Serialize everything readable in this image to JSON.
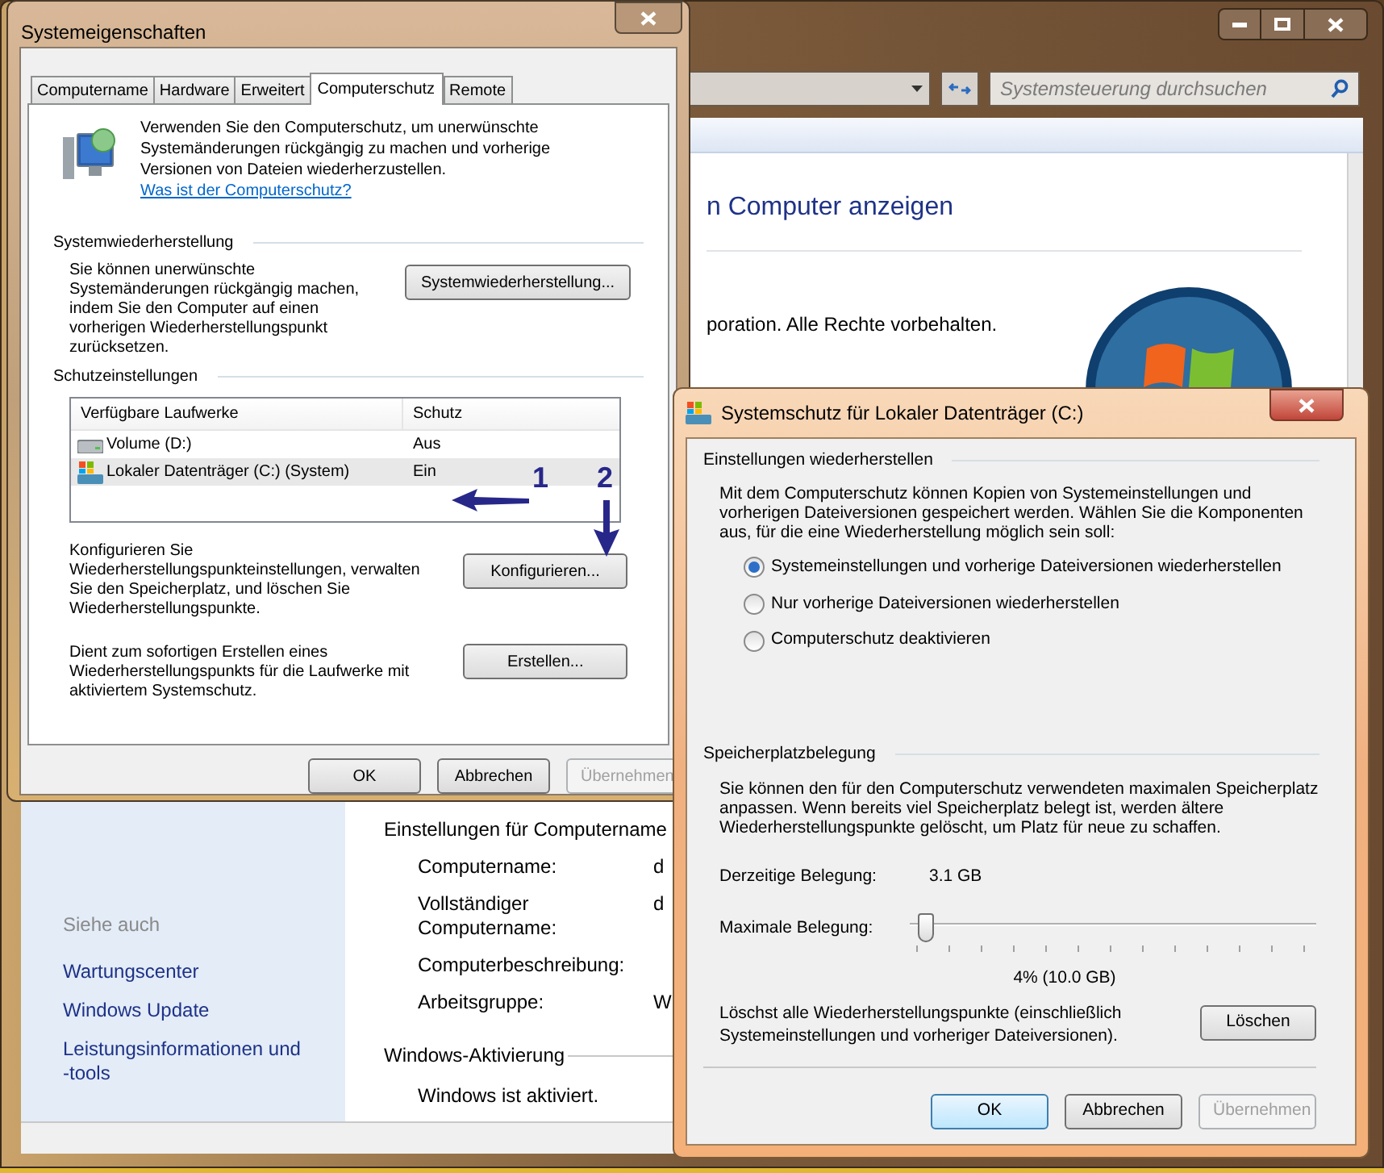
{
  "background_window": {
    "search": {
      "placeholder": "Systemsteuerung durchsuchen"
    },
    "heading": "n Computer anzeigen",
    "copyright": "poration. Alle Rechte vorbehalten.",
    "see_also": {
      "title": "Siehe auch",
      "links": [
        "Wartungscenter",
        "Windows Update",
        "Leistungsinformationen und -tools"
      ]
    },
    "computer_section": {
      "title": "Einstellungen für Computername",
      "rows": [
        {
          "label": "Computername:",
          "value": "d"
        },
        {
          "label": "Vollständiger Computername:",
          "value": "d"
        },
        {
          "label": "Computerbeschreibung:"
        },
        {
          "label": "Arbeitsgruppe:",
          "value": "W"
        }
      ]
    },
    "activation": {
      "title": "Windows-Aktivierung",
      "status": "Windows ist aktiviert."
    }
  },
  "system_properties": {
    "title": "Systemeigenschaften",
    "tabs": [
      {
        "label": "Computername",
        "selected": false
      },
      {
        "label": "Hardware",
        "selected": false
      },
      {
        "label": "Erweitert",
        "selected": false
      },
      {
        "label": "Computerschutz",
        "selected": true
      },
      {
        "label": "Remote",
        "selected": false
      }
    ],
    "intro": "Verwenden Sie den Computerschutz, um unerwünschte Systemänderungen rückgängig zu machen und vorherige Versionen von Dateien wiederherzustellen.",
    "intro_link": "Was ist der Computerschutz?",
    "restore": {
      "title": "Systemwiederherstellung",
      "text": "Sie können unerwünschte Systemänderungen rückgängig machen, indem Sie den Computer auf einen vorherigen Wiederherstellungspunkt zurücksetzen.",
      "button": "Systemwiederherstellung..."
    },
    "protection": {
      "title": "Schutzeinstellungen",
      "columns": [
        "Verfügbare Laufwerke",
        "Schutz"
      ],
      "rows": [
        {
          "kind": "volume",
          "name": "Volume (D:)",
          "protection": "Aus",
          "selected": false
        },
        {
          "kind": "system",
          "name": "Lokaler Datenträger (C:) (System)",
          "protection": "Ein",
          "selected": true
        }
      ],
      "configure_text": "Konfigurieren Sie Wiederherstellungspunkteinstellungen, verwalten Sie den Speicherplatz, und löschen Sie Wiederherstellungspunkte.",
      "configure_button": "Konfigurieren...",
      "create_text": "Dient zum sofortigen Erstellen eines Wiederherstellungspunkts für die Laufwerke mit aktiviertem Systemschutz.",
      "create_button": "Erstellen..."
    },
    "buttons": [
      {
        "label": "OK",
        "disabled": false
      },
      {
        "label": "Abbrechen",
        "disabled": false
      },
      {
        "label": "Übernehmen",
        "disabled": true
      }
    ]
  },
  "annotations": [
    {
      "label": "1"
    },
    {
      "label": "2"
    }
  ],
  "protection_dialog": {
    "title": "Systemschutz für Lokaler Datenträger (C:)",
    "restore_settings": {
      "title": "Einstellungen wiederherstellen",
      "text": "Mit dem Computerschutz können Kopien von Systemeinstellungen und vorherigen Dateiversionen gespeichert werden. Wählen Sie die Komponenten aus, für die eine Wiederherstellung möglich sein soll:",
      "options": [
        {
          "label": "Systemeinstellungen und vorherige Dateiversionen wiederherstellen",
          "selected": true
        },
        {
          "label": "Nur vorherige Dateiversionen wiederherstellen",
          "selected": false
        },
        {
          "label": "Computerschutz deaktivieren",
          "selected": false
        }
      ]
    },
    "disk_usage": {
      "title": "Speicherplatzbelegung",
      "text": "Sie können den für den Computerschutz verwendeten maximalen Speicherplatz anpassen. Wenn bereits viel Speicherplatz belegt ist, werden ältere Wiederherstellungspunkte gelöscht, um Platz für neue zu schaffen.",
      "current_label": "Derzeitige Belegung:",
      "current_value": "3.1 GB",
      "max_label": "Maximale Belegung:",
      "level": 0.04,
      "reading": "4% (10.0 GB)",
      "delete_text": "Löschst alle Wiederherstellungspunkte (einschließlich Systemeinstellungen und vorheriger Dateiversionen).",
      "delete_button": "Löschen"
    },
    "buttons": [
      {
        "label": "OK",
        "disabled": false,
        "default": true
      },
      {
        "label": "Abbrechen",
        "disabled": false,
        "default": false
      },
      {
        "label": "Übernehmen",
        "disabled": true,
        "default": false
      }
    ]
  }
}
